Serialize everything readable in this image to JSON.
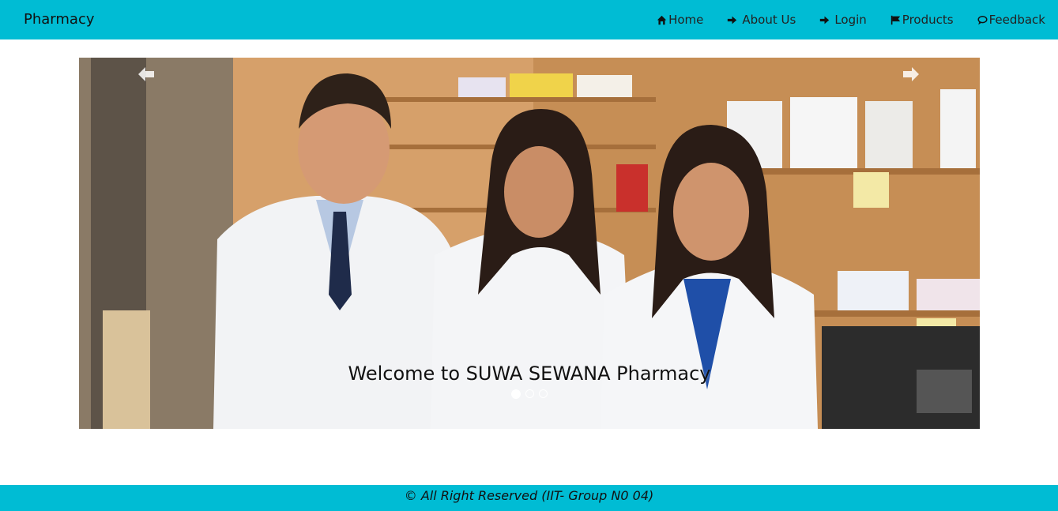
{
  "navbar": {
    "brand": "Pharmacy",
    "items": [
      {
        "label": "Home",
        "icon": "home-icon"
      },
      {
        "label": "About Us",
        "icon": "sign-in-icon"
      },
      {
        "label": "Login",
        "icon": "sign-in-icon"
      },
      {
        "label": "Products",
        "icon": "flag-icon"
      },
      {
        "label": "Feedback",
        "icon": "comment-icon"
      }
    ]
  },
  "carousel": {
    "caption": "Welcome to SUWA SEWANA Pharmacy",
    "slide_count": 3,
    "active_index": 0,
    "prev_icon": "arrow-left-icon",
    "next_icon": "arrow-right-icon"
  },
  "footer": {
    "text": "© All Right Reserved (IIT- Group N0 04)"
  },
  "colors": {
    "accent": "#00bcd4"
  }
}
